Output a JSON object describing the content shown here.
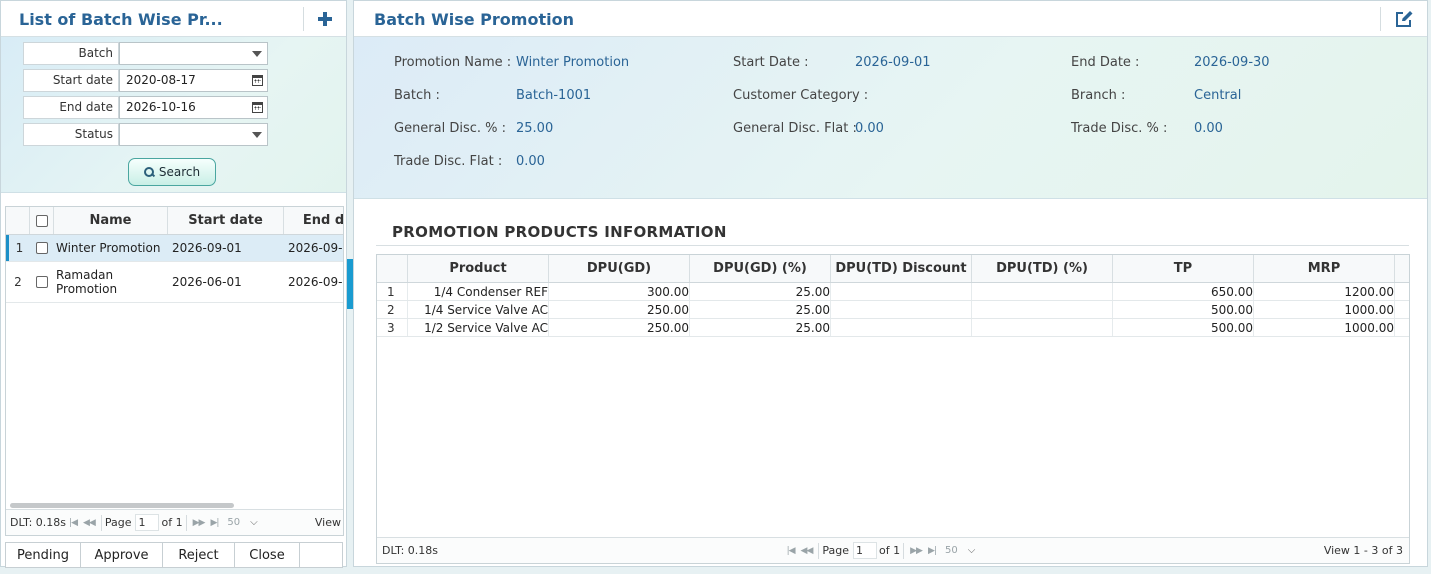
{
  "left": {
    "title": "List of Batch Wise Pr...",
    "filters": {
      "batch": {
        "label": "Batch",
        "value": ""
      },
      "start_date": {
        "label": "Start date",
        "value": "2020-08-17"
      },
      "end_date": {
        "label": "End date",
        "value": "2026-10-16"
      },
      "status": {
        "label": "Status",
        "value": ""
      }
    },
    "search_label": "Search",
    "grid": {
      "columns": [
        "Name",
        "Start date",
        "End d"
      ],
      "rows": [
        {
          "num": "1",
          "name": "Winter Promotion",
          "start": "2026-09-01",
          "end": "2026-09-",
          "selected": true
        },
        {
          "num": "2",
          "name": "Ramadan Promotion",
          "start": "2026-06-01",
          "end": "2026-09-",
          "selected": false
        }
      ]
    },
    "pager": {
      "dlt": "DLT: 0.18s",
      "page_label": "Page",
      "page": "1",
      "of": "of 1",
      "rows": "50",
      "view": "View"
    },
    "actions": [
      "Pending",
      "Approve",
      "Reject",
      "Close"
    ]
  },
  "right": {
    "title": "Batch Wise Promotion",
    "info": {
      "promotion_name": {
        "label": "Promotion Name",
        "value": "Winter Promotion"
      },
      "start_date": {
        "label": "Start Date",
        "value": "2026-09-01"
      },
      "end_date": {
        "label": "End Date",
        "value": "2026-09-30"
      },
      "batch": {
        "label": "Batch",
        "value": "Batch-1001"
      },
      "customer_category": {
        "label": "Customer Category",
        "value": ""
      },
      "branch": {
        "label": "Branch",
        "value": "Central"
      },
      "general_disc_pct": {
        "label": "General Disc. %",
        "value": "25.00"
      },
      "general_disc_flat": {
        "label": "General Disc. Flat",
        "value": "0.00"
      },
      "trade_disc_pct": {
        "label": "Trade Disc. %",
        "value": "0.00"
      },
      "trade_disc_flat": {
        "label": "Trade Disc. Flat",
        "value": "0.00"
      }
    },
    "section_title": "PROMOTION PRODUCTS INFORMATION",
    "products": {
      "columns": [
        "Product",
        "DPU(GD)",
        "DPU(GD) (%)",
        "DPU(TD) Discount",
        "DPU(TD) (%)",
        "TP",
        "MRP"
      ],
      "rows": [
        {
          "num": "1",
          "product": "1/4 Condenser REF",
          "dpu_gd": "300.00",
          "dpu_gd_pct": "25.00",
          "dpu_td_disc": "",
          "dpu_td_pct": "",
          "tp": "650.00",
          "mrp": "1200.00"
        },
        {
          "num": "2",
          "product": "1/4 Service Valve AC",
          "dpu_gd": "250.00",
          "dpu_gd_pct": "25.00",
          "dpu_td_disc": "",
          "dpu_td_pct": "",
          "tp": "500.00",
          "mrp": "1000.00"
        },
        {
          "num": "3",
          "product": "1/2 Service Valve AC",
          "dpu_gd": "250.00",
          "dpu_gd_pct": "25.00",
          "dpu_td_disc": "",
          "dpu_td_pct": "",
          "tp": "500.00",
          "mrp": "1000.00"
        }
      ]
    },
    "pager": {
      "dlt": "DLT: 0.18s",
      "page_label": "Page",
      "page": "1",
      "of": "of 1",
      "rows": "50",
      "view": "View 1 - 3 of 3"
    }
  },
  "icons": {
    "add": "plus-icon",
    "edit": "edit-icon",
    "search": "search-icon",
    "calendar": "calendar-icon",
    "dropdown": "chevron-down-icon"
  },
  "colors": {
    "title": "#2a6496",
    "selected_row": "#dcecf6",
    "accent": "#1a9bd0"
  }
}
